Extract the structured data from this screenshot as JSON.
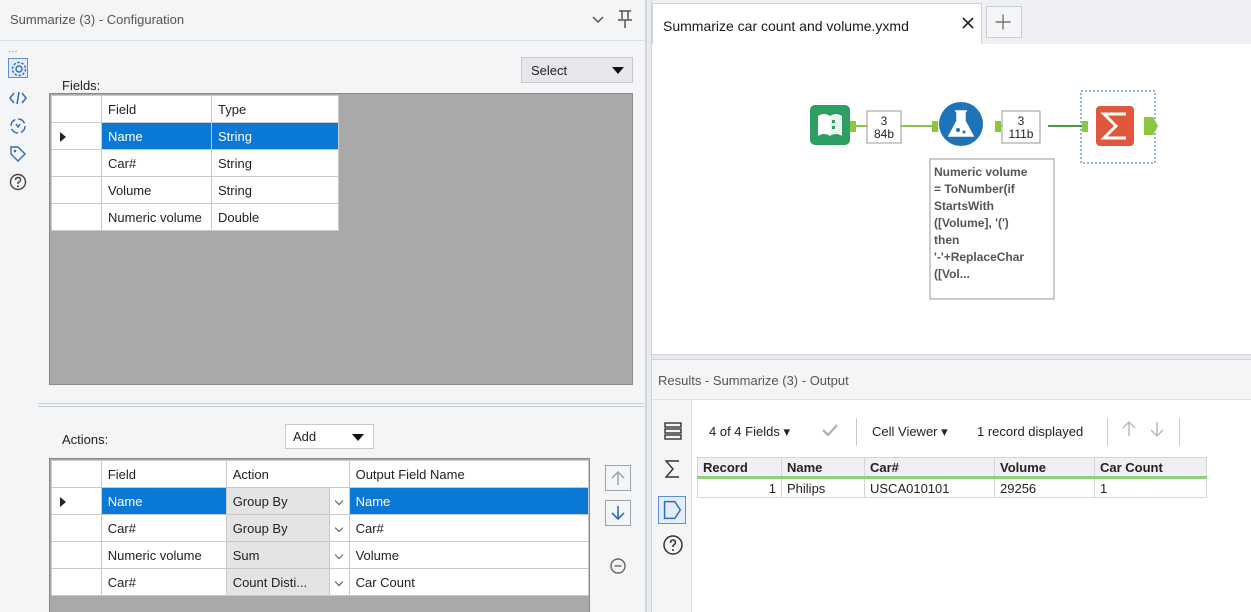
{
  "config": {
    "title": "Summarize (3) - Configuration",
    "sidebar_dots": "…",
    "fields_label": "Fields:",
    "select_label": "Select",
    "fields_columns": [
      "Field",
      "Type"
    ],
    "fields_rows": [
      {
        "field": "Name",
        "type": "String"
      },
      {
        "field": "Car#",
        "type": "String"
      },
      {
        "field": "Volume",
        "type": "String"
      },
      {
        "field": "Numeric volume",
        "type": "Double"
      }
    ],
    "actions_label": "Actions:",
    "add_label": "Add",
    "actions_columns": [
      "Field",
      "Action",
      "Output Field Name"
    ],
    "actions_rows": [
      {
        "field": "Name",
        "action": "Group By",
        "output": "Name"
      },
      {
        "field": "Car#",
        "action": "Group By",
        "output": "Car#"
      },
      {
        "field": "Numeric volume",
        "action": "Sum",
        "output": "Volume"
      },
      {
        "field": "Car#",
        "action": "Count Disti...",
        "output": "Car Count"
      }
    ]
  },
  "workflow_tab": {
    "title": "Summarize car count and volume.yxmd"
  },
  "canvas": {
    "conn1_records": "3",
    "conn1_size": "84b",
    "conn2_records": "3",
    "conn2_size": "111b",
    "annotation": [
      "Numeric volume",
      "= ToNumber(if",
      "StartsWith",
      "([Volume], '(')",
      "then",
      "'-'+ReplaceChar",
      "([Vol..."
    ],
    "colors": {
      "input": "#2e9e62",
      "formula": "#1f73b7",
      "summarize": "#e0583c",
      "anchor": "#8cc63f"
    }
  },
  "results": {
    "title": "Results - Summarize (3) - Output",
    "fields_count": "4 of 4 Fields",
    "cell_viewer": "Cell Viewer",
    "records_displayed": "1 record displayed",
    "columns": [
      "Record",
      "Name",
      "Car#",
      "Volume",
      "Car Count"
    ],
    "row": [
      "1",
      "Philips",
      "USCA010101",
      "29256",
      "1"
    ]
  }
}
